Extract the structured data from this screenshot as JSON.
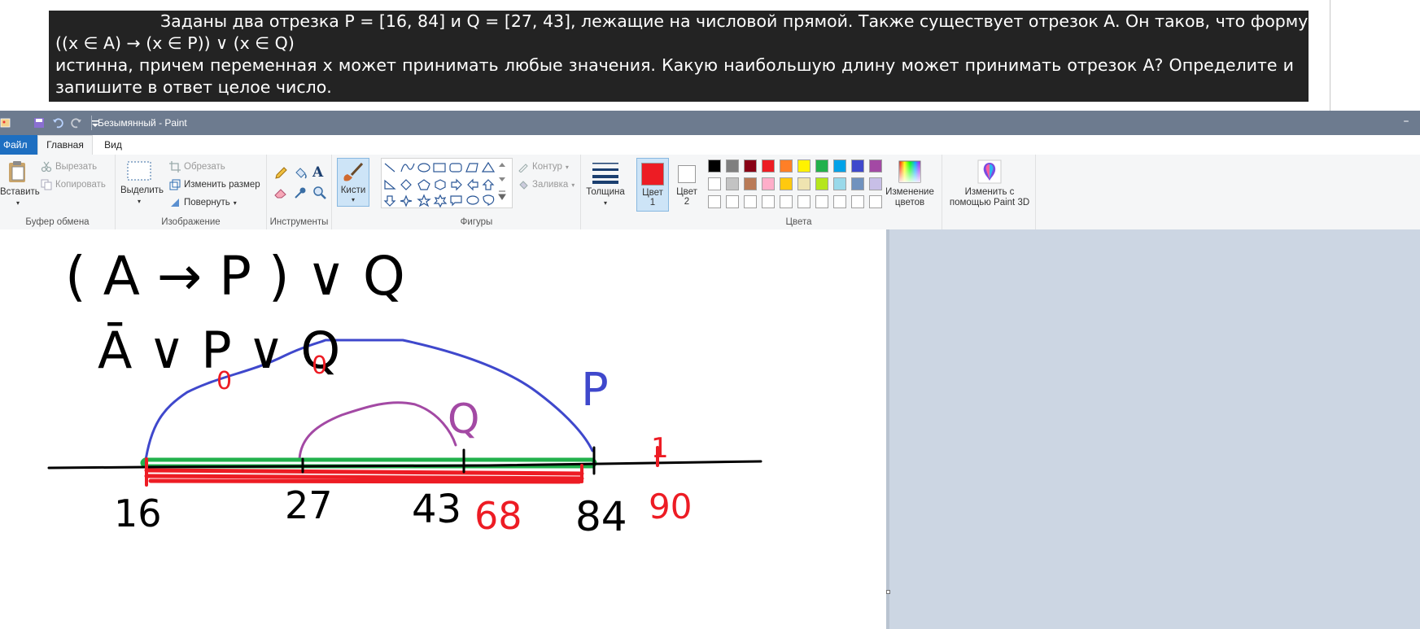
{
  "question": {
    "line1": "Заданы два отрезка P = [16, 84] и Q = [27, 43], лежащие на числовой прямой. Также существует отрезок A. Он таков, что формула",
    "line2": "((x ∈ A) → (x ∈ P)) ∨ (x ∈ Q)",
    "line3": "истинна, причем переменная x может принимать любые значения. Какую наибольшую длину может принимать отрезок A? Определите и",
    "line4": "запишите в ответ целое число."
  },
  "window": {
    "title": "Безымянный - Paint",
    "minimize_glyph": "–"
  },
  "tabs": {
    "file": "Файл",
    "home": "Главная",
    "view": "Вид"
  },
  "ribbon": {
    "clipboard": {
      "label": "Буфер обмена",
      "paste": "Вставить",
      "cut": "Вырезать",
      "copy": "Копировать"
    },
    "image": {
      "label": "Изображение",
      "select": "Выделить",
      "crop": "Обрезать",
      "resize": "Изменить размер",
      "rotate": "Повернуть"
    },
    "tools": {
      "label": "Инструменты",
      "text_tool_glyph": "A"
    },
    "brushes": {
      "label": "Кисти"
    },
    "shapes": {
      "label": "Фигуры",
      "outline": "Контур",
      "fill": "Заливка"
    },
    "thickness": {
      "label": "Толщина"
    },
    "color1": {
      "label_line1": "Цвет",
      "label_line2": "1",
      "value": "#ed1c24"
    },
    "color2": {
      "label_line1": "Цвет",
      "label_line2": "2",
      "value": "#ffffff"
    },
    "colors": {
      "label": "Цвета",
      "edit_line1": "Изменение",
      "edit_line2": "цветов",
      "palette_row1": [
        "#000000",
        "#7f7f7f",
        "#880015",
        "#ed1c24",
        "#ff7f27",
        "#fff200",
        "#22b14c",
        "#00a2e8",
        "#3f48cc",
        "#a349a4"
      ],
      "palette_row2": [
        "#ffffff",
        "#c3c3c3",
        "#b97a57",
        "#ffaec9",
        "#ffc90e",
        "#efe4b0",
        "#b5e61d",
        "#99d9ea",
        "#7092be",
        "#c8bfe7"
      ],
      "palette_row3": [
        "#ffffff",
        "#ffffff",
        "#ffffff",
        "#ffffff",
        "#ffffff",
        "#ffffff",
        "#ffffff",
        "#ffffff",
        "#ffffff",
        "#ffffff"
      ]
    },
    "paint3d": {
      "line1": "Изменить с",
      "line2": "помощью Paint 3D"
    }
  },
  "drawing": {
    "formula1": "( A → P ) ∨ Q",
    "formula2": "Ā ∨ P ∨ Q",
    "label_P": "P",
    "label_Q": "Q",
    "zero_a": "0",
    "zero_b": "0",
    "one": "1",
    "n16": "16",
    "n27": "27",
    "n43": "43",
    "n68": "68",
    "n84": "84",
    "n90": "90"
  }
}
